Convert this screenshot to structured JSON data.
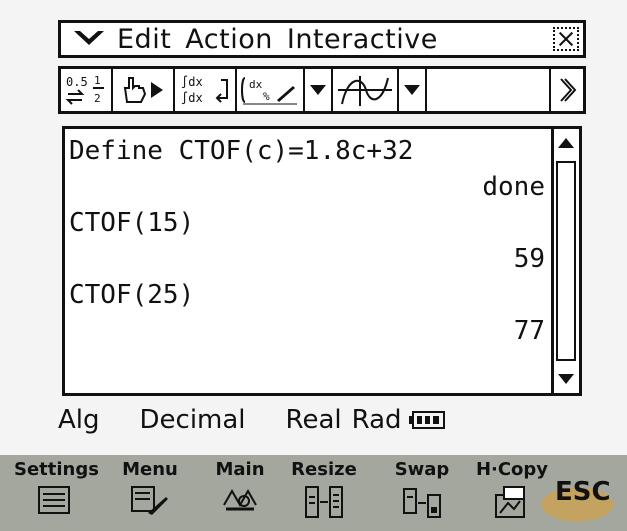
{
  "menu": {
    "items": [
      "Edit",
      "Action",
      "Interactive"
    ]
  },
  "toolbar": {
    "fraction_top": "0.5",
    "integral_top": "∫dx",
    "integral_bottom": "∫dx"
  },
  "workarea": {
    "lines": [
      {
        "text": "Define CTOF(c)=1.8c+32",
        "align": "left"
      },
      {
        "text": "done",
        "align": "right"
      },
      {
        "text": "CTOF(15)",
        "align": "left"
      },
      {
        "text": "59",
        "align": "right"
      },
      {
        "text": "CTOF(25)",
        "align": "left"
      },
      {
        "text": "77",
        "align": "right"
      }
    ]
  },
  "status": {
    "mode": "Alg",
    "number_format": "Decimal",
    "domain": "Real",
    "angle": "Rad"
  },
  "hardkeys": [
    {
      "label": "Settings",
      "icon": "settings-icon"
    },
    {
      "label": "Menu",
      "icon": "menu-icon"
    },
    {
      "label": "Main",
      "icon": "main-icon"
    },
    {
      "label": "Resize",
      "icon": "resize-icon"
    },
    {
      "label": "Swap",
      "icon": "swap-icon"
    },
    {
      "label": "H·Copy",
      "icon": "hcopy-icon"
    }
  ],
  "esc_label": "ESC"
}
